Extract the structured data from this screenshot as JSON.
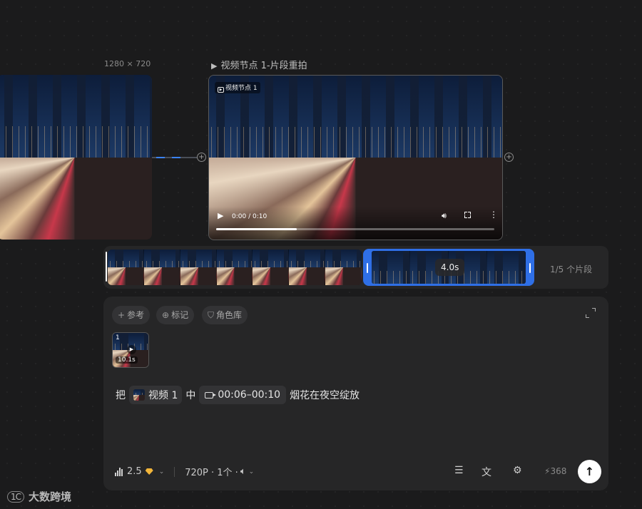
{
  "canvas": {
    "left_card": {
      "dimension_label": "1280 × 720"
    },
    "main_node": {
      "title": "视频节点 1-片段重拍",
      "badge": "视频节点 1",
      "time": "0:00 / 0:10",
      "progress_fraction": 0.29
    }
  },
  "filmstrip": {
    "selected_duration": "4.0s",
    "segment_count": "1/5 个片段"
  },
  "panel": {
    "chips": {
      "reference": "参考",
      "mark": "标记",
      "role_library": "角色库"
    },
    "thumbnail": {
      "index": "1",
      "duration": "10.1s"
    },
    "prompt": {
      "prefix": "把",
      "video_ref": "视频 1",
      "middle": "中",
      "time_range": "00:06–00:10",
      "suffix": "烟花在夜空绽放"
    },
    "bottom": {
      "model_version": "2.5",
      "settings": "720P · 1个 ·",
      "credits": "368"
    }
  },
  "logo": {
    "text": "大数跨境",
    "mark": "1C"
  }
}
